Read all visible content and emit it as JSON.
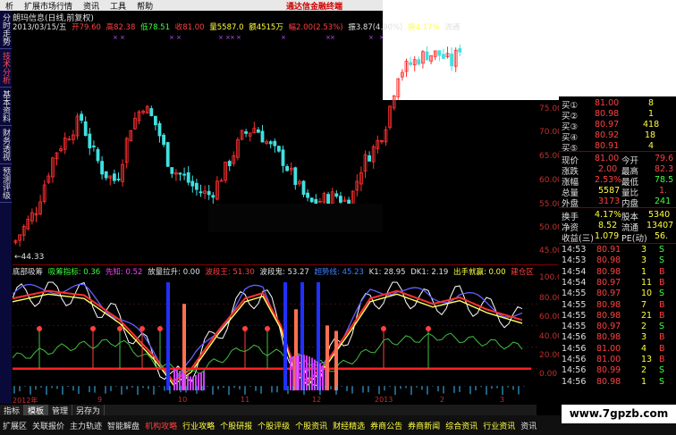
{
  "menu": {
    "items": [
      "析",
      "扩展市场行情",
      "资讯",
      "工具",
      "帮助"
    ]
  },
  "brand": "通达信金融终端",
  "left_tabs": [
    {
      "label": "分时走势",
      "active": false
    },
    {
      "label": "技术分析",
      "active": true
    },
    {
      "label": "基本资料",
      "active": false
    },
    {
      "label": "财务透视",
      "active": false
    },
    {
      "label": "预测评级",
      "active": false
    }
  ],
  "info_head": "朗玛信息(日线,前复权)",
  "quote": {
    "date": "2013/03/15/五",
    "open": "开79.60",
    "high": "高82.38",
    "low": "低78.51",
    "close": "收81.00",
    "vol": "量5587.0",
    "amount": "额4515万",
    "change": "幅2.00(2.53%)",
    "amp": "振3.87(4.90%)",
    "turnover": "换4.17%",
    "tail": "流通"
  },
  "main_axis": [
    "75.00",
    "70.00",
    "65.00",
    "60.00",
    "55.00",
    "50.00",
    "45.00"
  ],
  "low_mark": "←44.33",
  "indicator": {
    "name": "底部吸筹",
    "items": [
      {
        "t": "吸筹指标: 0.36",
        "c": "g"
      },
      {
        "t": "先知: 0.52",
        "c": "m"
      },
      {
        "t": "放量拉升: 0.00",
        "c": "w"
      },
      {
        "t": "波段王: 51.30",
        "c": "r"
      },
      {
        "t": "波段鬼: 53.27",
        "c": "w"
      },
      {
        "t": "超势线: 45.23",
        "c": "b"
      },
      {
        "t": "K1: 28.95",
        "c": "w"
      },
      {
        "t": "DK1: 2.19",
        "c": "w"
      },
      {
        "t": "出手就赢: 0.00",
        "c": "y"
      },
      {
        "t": "建仓区",
        "c": "r"
      }
    ]
  },
  "ind_axis": [
    "100.00",
    "80.00",
    "60.00",
    "40.00",
    "20.00",
    "0.00"
  ],
  "date_labels": [
    "2012年",
    "9",
    "10",
    "11",
    "12",
    "2013",
    "2",
    "3"
  ],
  "bottom_tabs": [
    {
      "label": "指标",
      "act": false
    },
    {
      "label": "模板",
      "act": true
    },
    {
      "label": "管理",
      "act": false
    },
    {
      "label": "另存为",
      "act": false
    }
  ],
  "footer": [
    "扩展区",
    "关联报价",
    "主力轨迹",
    "智能解盘",
    "机构攻略",
    "行业攻略",
    "个股研报",
    "个股评级",
    "个股资讯",
    "财经精选",
    "券商公告",
    "券商新闻",
    "综合资讯",
    "行业资讯",
    "资讯"
  ],
  "watermark": "www.7gpzb.com",
  "order_book": [
    {
      "l": "买①",
      "p": "81.00",
      "v": "8"
    },
    {
      "l": "买②",
      "p": "80.98",
      "v": "1"
    },
    {
      "l": "买③",
      "p": "80.97",
      "v": "418"
    },
    {
      "l": "买④",
      "p": "80.92",
      "v": "18"
    },
    {
      "l": "买⑤",
      "p": "80.91",
      "v": "4"
    }
  ],
  "stats": [
    {
      "a": "现价",
      "av": "81.00",
      "b": "今开",
      "bv": "79.6"
    },
    {
      "a": "涨跌",
      "av": "2.00",
      "b": "最高",
      "bv": "82.3"
    },
    {
      "a": "涨幅",
      "av": "2.53%",
      "b": "最低",
      "bv": "78.5"
    },
    {
      "a": "总量",
      "av": "5587",
      "b": "量比",
      "bv": "1."
    },
    {
      "a": "外盘",
      "av": "3173",
      "b": "内盘",
      "bv": "241"
    }
  ],
  "stats2": [
    {
      "a": "换手",
      "av": "4.17%",
      "b": "股本",
      "bv": "5340"
    },
    {
      "a": "净资",
      "av": "8.52",
      "b": "流通",
      "bv": "13407"
    },
    {
      "a": "收益(三)",
      "av": "1.079",
      "b": "PE(动)",
      "bv": "56."
    }
  ],
  "ticks": [
    {
      "t": "14:53",
      "p": "80.91",
      "v": "3",
      "s": "S"
    },
    {
      "t": "14:53",
      "p": "80.98",
      "v": "3",
      "s": "S"
    },
    {
      "t": "14:54",
      "p": "80.98",
      "v": "1",
      "s": "B"
    },
    {
      "t": "14:54",
      "p": "80.97",
      "v": "11",
      "s": "B"
    },
    {
      "t": "14:55",
      "p": "80.97",
      "v": "10",
      "s": "S"
    },
    {
      "t": "14:55",
      "p": "80.98",
      "v": "7",
      "s": "B"
    },
    {
      "t": "14:55",
      "p": "80.98",
      "v": "21",
      "s": "B"
    },
    {
      "t": "14:55",
      "p": "80.97",
      "v": "2",
      "s": "S"
    },
    {
      "t": "14:56",
      "p": "80.98",
      "v": "3",
      "s": "B"
    },
    {
      "t": "14:56",
      "p": "81.00",
      "v": "4",
      "s": "B"
    },
    {
      "t": "14:56",
      "p": "81.00",
      "v": "13",
      "s": "B"
    },
    {
      "t": "14:56",
      "p": "80.99",
      "v": "2",
      "s": "S"
    },
    {
      "t": "14:56",
      "p": "80.98",
      "v": "1",
      "s": "S"
    }
  ],
  "colors": {
    "up": "#ff3030",
    "down": "#40e0e0",
    "axis": "#c03030",
    "bg": "#000000"
  }
}
